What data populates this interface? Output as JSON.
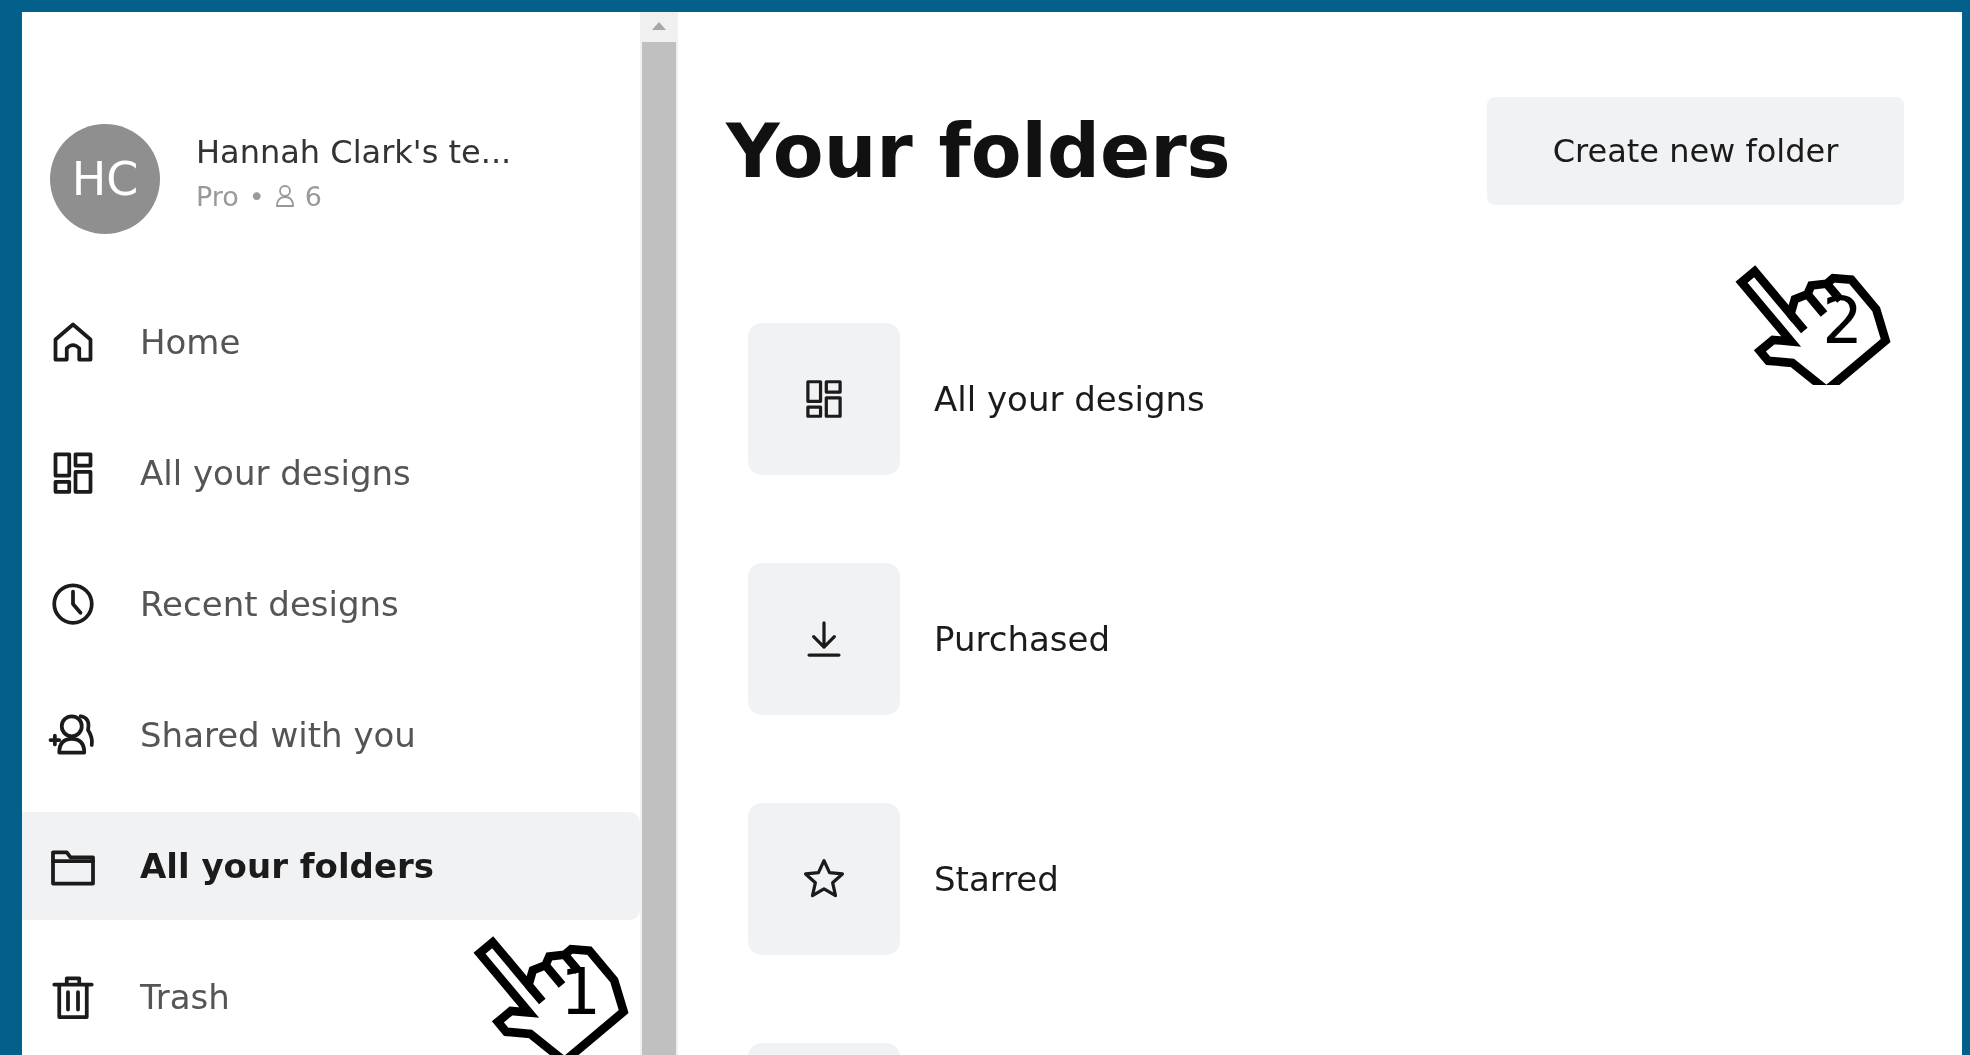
{
  "team": {
    "initials": "HC",
    "name": "Hannah Clark's te...",
    "plan": "Pro",
    "dot": "•",
    "members": "6"
  },
  "sidebar": {
    "items": [
      {
        "label": "Home",
        "kind": "home",
        "selected": false
      },
      {
        "label": "All your designs",
        "kind": "grid",
        "selected": false
      },
      {
        "label": "Recent designs",
        "kind": "clock",
        "selected": false
      },
      {
        "label": "Shared with you",
        "kind": "people",
        "selected": false
      },
      {
        "label": "All your folders",
        "kind": "folder",
        "selected": true
      },
      {
        "label": "Trash",
        "kind": "trash",
        "selected": false
      }
    ]
  },
  "main": {
    "title": "Your folders",
    "button": "Create new folder",
    "folders": [
      {
        "label": "All your designs",
        "kind": "grid"
      },
      {
        "label": "Purchased",
        "kind": "download"
      },
      {
        "label": "Starred",
        "kind": "star"
      }
    ]
  },
  "callouts": [
    {
      "number": "1"
    },
    {
      "number": "2"
    }
  ]
}
